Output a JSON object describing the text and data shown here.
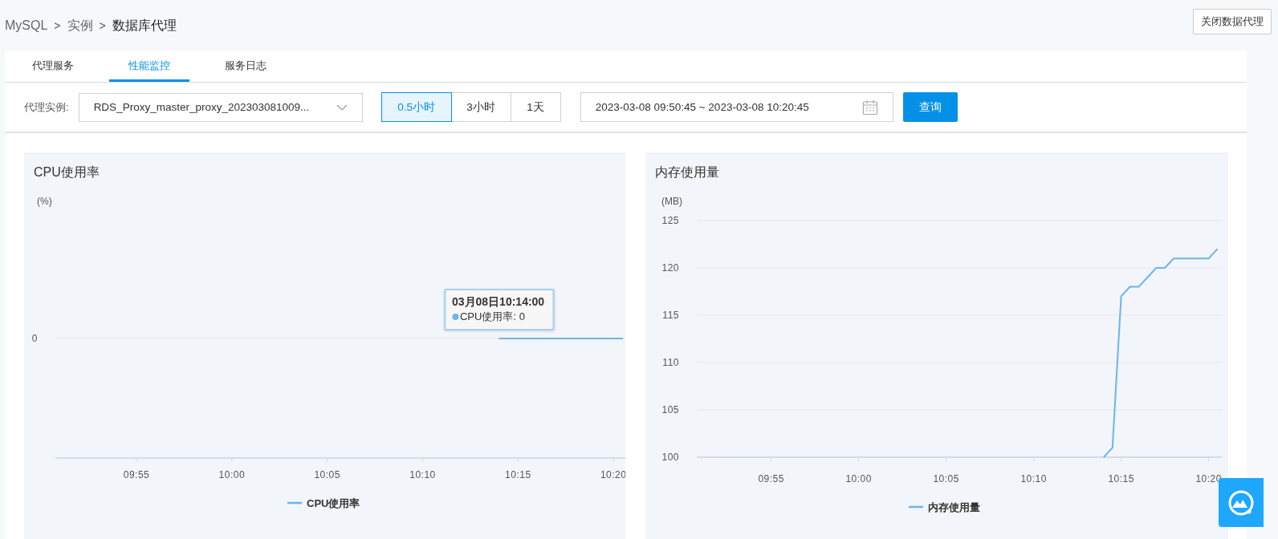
{
  "breadcrumb": [
    {
      "label": "MySQL",
      "current": false
    },
    {
      "label": "实例",
      "current": false
    },
    {
      "label": "数据库代理",
      "current": true
    }
  ],
  "breadcrumb_separator": ">",
  "header_button": "关闭数据代理",
  "tabs": [
    {
      "label": "代理服务",
      "selected": false
    },
    {
      "label": "性能监控",
      "selected": true
    },
    {
      "label": "服务日志",
      "selected": false
    }
  ],
  "filter": {
    "label": "代理实例:",
    "instance": "RDS_Proxy_master_proxy_202303081009...",
    "ranges": [
      {
        "label": "0.5小时",
        "selected": true
      },
      {
        "label": "3小时",
        "selected": false
      },
      {
        "label": "1天",
        "selected": false
      }
    ],
    "date_range": "2023-03-08 09:50:45 ~ 2023-03-08 10:20:45",
    "query_button": "查询"
  },
  "panels": [
    {
      "title": "CPU使用率",
      "unit": "(%)",
      "tooltip": {
        "title": "03月08日10:14:00",
        "label": "CPU使用率: 0"
      },
      "y_label": "0",
      "x_labels": [
        "09:55",
        "10:00",
        "10:05",
        "10:10",
        "10:15",
        "10:20"
      ],
      "legend": "CPU使用率"
    },
    {
      "title": "内存使用量",
      "unit": "(MB)",
      "chart_data": {
        "type": "line",
        "grid": true,
        "categories": [
          null,
          null,
          null,
          null,
          null,
          null,
          null,
          null,
          "09:55",
          null,
          null,
          null,
          null,
          null,
          null,
          null,
          null,
          null,
          "10:00",
          null,
          null,
          null,
          null,
          null,
          null,
          null,
          null,
          null,
          "10:05",
          null,
          null,
          null,
          null,
          null,
          null,
          null,
          null,
          null,
          "10:10",
          null,
          null,
          null,
          null,
          null,
          null,
          null,
          null,
          null,
          "10:15",
          null,
          null,
          null,
          null,
          null,
          null,
          null,
          null,
          null,
          "10:20",
          null
        ],
        "series": [
          {
            "name": "内存使用量",
            "color": "#6cb4ee",
            "values": [
              null,
              null,
              null,
              null,
              null,
              null,
              null,
              null,
              null,
              null,
              null,
              null,
              null,
              null,
              null,
              null,
              null,
              null,
              null,
              null,
              null,
              null,
              null,
              null,
              null,
              null,
              null,
              null,
              null,
              null,
              null,
              null,
              null,
              null,
              null,
              null,
              null,
              null,
              null,
              null,
              null,
              null,
              null,
              null,
              null,
              null,
              100,
              101,
              117,
              118,
              118,
              119,
              120,
              120,
              121,
              121,
              121,
              121,
              121,
              122
            ]
          }
        ],
        "ylim": [
          100,
          125
        ],
        "yticks": [
          100,
          105,
          110,
          115,
          120,
          125
        ]
      }
    }
  ]
}
